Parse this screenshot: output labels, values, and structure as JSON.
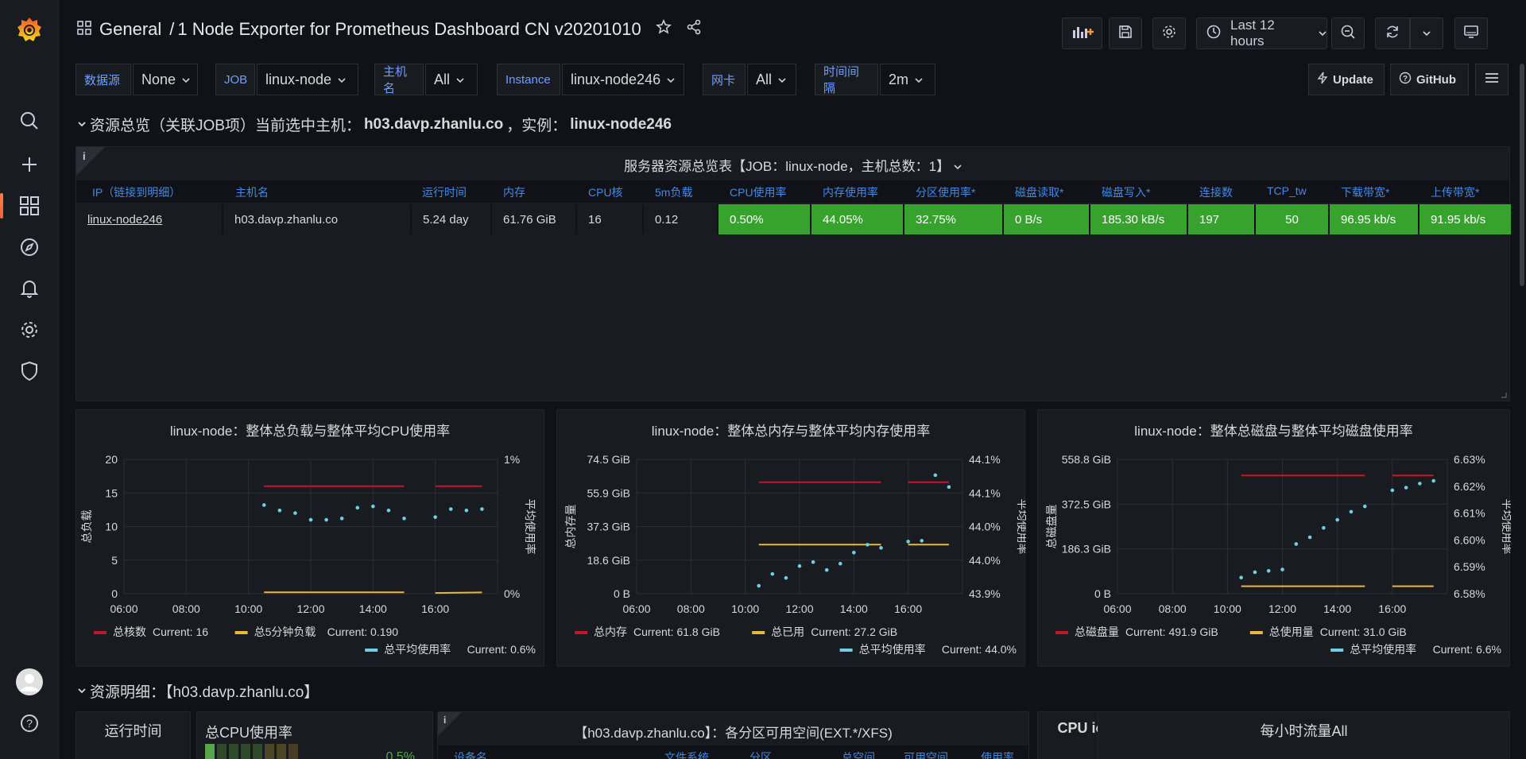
{
  "breadcrumb": {
    "folder": "General",
    "separator": "/",
    "dashboard": "1 Node Exporter for Prometheus Dashboard CN v20201010"
  },
  "toolbar": {
    "time_range": "Last 12 hours"
  },
  "variables": [
    {
      "label": "数据源",
      "value": "None"
    },
    {
      "label": "JOB",
      "value": "linux-node"
    },
    {
      "label": "主机名",
      "value": "All"
    },
    {
      "label": "Instance",
      "value": "linux-node246"
    },
    {
      "label": "网卡",
      "value": "All"
    },
    {
      "label": "时间间隔",
      "value": "2m"
    }
  ],
  "links": {
    "update": "Update",
    "github": "GitHub"
  },
  "row1": {
    "title_prefix": "资源总览（关联JOB项）当前选中主机：",
    "host": "h03.davp.zhanlu.co",
    "mid": "，实例：",
    "instance": "linux-node246"
  },
  "table_panel": {
    "title": "服务器资源总览表【JOB：linux-node，主机总数：1】",
    "headers": [
      "IP（链接到明细）",
      "主机名",
      "运行时间",
      "内存",
      "CPU核",
      "5m负载",
      "CPU使用率",
      "内存使用率",
      "分区使用率*",
      "磁盘读取*",
      "磁盘写入*",
      "连接数",
      "TCP_tw",
      "下载带宽*",
      "上传带宽*"
    ],
    "row": [
      "linux-node246",
      "h03.davp.zhanlu.co",
      "5.24 day",
      "61.76 GiB",
      "16",
      "0.12",
      "0.50%",
      "44.05%",
      "32.75%",
      "0 B/s",
      "185.30 kB/s",
      "197",
      "50",
      "96.95 kb/s",
      "91.95 kb/s"
    ]
  },
  "charts_text": [
    {
      "title": "linux-node：整体总负载与整体平均CPU使用率",
      "y_left_title": "总负载",
      "y_right_title": "平均使用率",
      "y_left_ticks": [
        "20",
        "15",
        "10",
        "5",
        "0"
      ],
      "y_right_ticks": [
        "1%",
        "0%"
      ],
      "legend": [
        {
          "name": "总核数",
          "current": "Current: 16",
          "color": "#c4162a"
        },
        {
          "name": "总5分钟负载",
          "current": "Current: 0.190",
          "color": "#eab839"
        },
        {
          "name": "总平均使用率",
          "current": "Current: 0.6%",
          "color": "#6ed0e0"
        }
      ]
    },
    {
      "title": "linux-node：整体总内存与整体平均内存使用率",
      "y_left_title": "总内存量",
      "y_right_title": "平均使用率",
      "y_left_ticks": [
        "74.5 GiB",
        "55.9 GiB",
        "37.3 GiB",
        "18.6 GiB",
        "0 B"
      ],
      "y_right_ticks": [
        "44.1%",
        "44.1%",
        "44.0%",
        "44.0%",
        "43.9%"
      ],
      "legend": [
        {
          "name": "总内存",
          "current": "Current: 61.8 GiB",
          "color": "#c4162a"
        },
        {
          "name": "总已用",
          "current": "Current: 27.2 GiB",
          "color": "#eab839"
        },
        {
          "name": "总平均使用率",
          "current": "Current: 44.0%",
          "color": "#6ed0e0"
        }
      ]
    },
    {
      "title": "linux-node：整体总磁盘与整体平均磁盘使用率",
      "y_left_title": "总磁盘量",
      "y_right_title": "平均使用率",
      "y_left_ticks": [
        "558.8 GiB",
        "372.5 GiB",
        "186.3 GiB",
        "0 B"
      ],
      "y_right_ticks": [
        "6.63%",
        "6.62%",
        "6.61%",
        "6.60%",
        "6.59%",
        "6.58%"
      ],
      "legend": [
        {
          "name": "总磁盘量",
          "current": "Current: 491.9 GiB",
          "color": "#c4162a"
        },
        {
          "name": "总使用量",
          "current": "Current: 31.0 GiB",
          "color": "#eab839"
        },
        {
          "name": "总平均使用率",
          "current": "Current: 6.6%",
          "color": "#6ed0e0"
        }
      ]
    }
  ],
  "chart_data": [
    {
      "type": "line",
      "title": "linux-node：整体总负载与整体平均CPU使用率",
      "ylabel": "总负载",
      "y2label": "平均使用率",
      "x_ticks": [
        "06:00",
        "08:00",
        "10:00",
        "12:00",
        "14:00",
        "16:00"
      ],
      "ylim": [
        0,
        20
      ],
      "y2lim": [
        0,
        1
      ],
      "series": [
        {
          "name": "总核数",
          "axis": "left",
          "segments": [
            {
              "x": [
                10.5,
                15.0
              ],
              "y": [
                16,
                16
              ]
            },
            {
              "x": [
                16.0,
                17.5
              ],
              "y": [
                16,
                16
              ]
            }
          ]
        },
        {
          "name": "总5分钟负载",
          "axis": "left",
          "segments": [
            {
              "x": [
                10.5,
                15.0
              ],
              "y": [
                0.2,
                0.2
              ]
            },
            {
              "x": [
                16.0,
                17.5
              ],
              "y": [
                0.1,
                0.19
              ]
            }
          ]
        },
        {
          "name": "总平均使用率",
          "axis": "right",
          "points": {
            "x": [
              10.5,
              11.0,
              11.5,
              12.0,
              12.5,
              13.0,
              13.5,
              14.0,
              14.5,
              15.0,
              16.0,
              16.5,
              17.0,
              17.5
            ],
            "y": [
              0.66,
              0.62,
              0.6,
              0.55,
              0.55,
              0.56,
              0.64,
              0.65,
              0.62,
              0.56,
              0.57,
              0.63,
              0.62,
              0.63
            ]
          }
        }
      ]
    },
    {
      "type": "line",
      "title": "linux-node：整体总内存与整体平均内存使用率",
      "ylabel": "总内存量",
      "y2label": "平均使用率",
      "x_ticks": [
        "06:00",
        "08:00",
        "10:00",
        "12:00",
        "14:00",
        "16:00"
      ],
      "ylim": [
        0,
        74.5
      ],
      "y2lim": [
        43.95,
        44.12
      ],
      "series": [
        {
          "name": "总内存",
          "axis": "left",
          "segments": [
            {
              "x": [
                10.5,
                15.0
              ],
              "y": [
                61.8,
                61.8
              ]
            },
            {
              "x": [
                16.0,
                17.5
              ],
              "y": [
                61.8,
                61.8
              ]
            }
          ]
        },
        {
          "name": "总已用",
          "axis": "left",
          "segments": [
            {
              "x": [
                10.5,
                15.0
              ],
              "y": [
                27.2,
                27.2
              ]
            },
            {
              "x": [
                16.0,
                17.5
              ],
              "y": [
                27.2,
                27.2
              ]
            }
          ]
        },
        {
          "name": "总平均使用率",
          "axis": "right",
          "points": {
            "x": [
              10.5,
              11.0,
              11.5,
              12.0,
              12.5,
              13.0,
              13.5,
              14.0,
              14.5,
              15.0,
              16.0,
              16.5,
              17.0,
              17.5
            ],
            "y": [
              43.96,
              43.975,
              43.97,
              43.985,
              43.99,
              43.98,
              43.988,
              44.002,
              44.012,
              44.008,
              44.016,
              44.017,
              44.1,
              44.085
            ]
          }
        }
      ]
    },
    {
      "type": "line",
      "title": "linux-node：整体总磁盘与整体平均磁盘使用率",
      "ylabel": "总磁盘量",
      "y2label": "平均使用率",
      "x_ticks": [
        "06:00",
        "08:00",
        "10:00",
        "12:00",
        "14:00",
        "16:00"
      ],
      "ylim": [
        0,
        558.8
      ],
      "y2lim": [
        6.58,
        6.63
      ],
      "series": [
        {
          "name": "总磁盘量",
          "axis": "left",
          "segments": [
            {
              "x": [
                10.5,
                15.0
              ],
              "y": [
                491.9,
                491.9
              ]
            },
            {
              "x": [
                16.0,
                17.5
              ],
              "y": [
                491.9,
                491.9
              ]
            }
          ]
        },
        {
          "name": "总使用量",
          "axis": "left",
          "segments": [
            {
              "x": [
                10.5,
                15.0
              ],
              "y": [
                31.0,
                31.0
              ]
            },
            {
              "x": [
                16.0,
                17.5
              ],
              "y": [
                31.0,
                31.0
              ]
            }
          ]
        },
        {
          "name": "总平均使用率",
          "axis": "right",
          "points": {
            "x": [
              10.5,
              11.0,
              11.5,
              12.0,
              12.5,
              13.0,
              13.5,
              14.0,
              14.5,
              15.0,
              16.0,
              16.5,
              17.0,
              17.5
            ],
            "y": [
              6.586,
              6.588,
              6.5885,
              6.589,
              6.5985,
              6.601,
              6.6045,
              6.6075,
              6.6105,
              6.6125,
              6.6185,
              6.6195,
              6.621,
              6.622
            ]
          }
        }
      ]
    }
  ],
  "row2": {
    "title": "资源明细：【h03.davp.zhanlu.co】"
  },
  "bottom": {
    "uptime_title": "运行时间",
    "cpu_title": "总CPU使用率",
    "cpu_value": "0.5%",
    "partition_title": "【h03.davp.zhanlu.co】：各分区可用空间(EXT.*/XFS)",
    "partition_headers": [
      "设备名",
      "文件系统",
      "分区",
      "总空间",
      "可用空间",
      "使用率"
    ],
    "iowait_title": "CPU iowait",
    "traffic_title": "每小时流量All"
  }
}
